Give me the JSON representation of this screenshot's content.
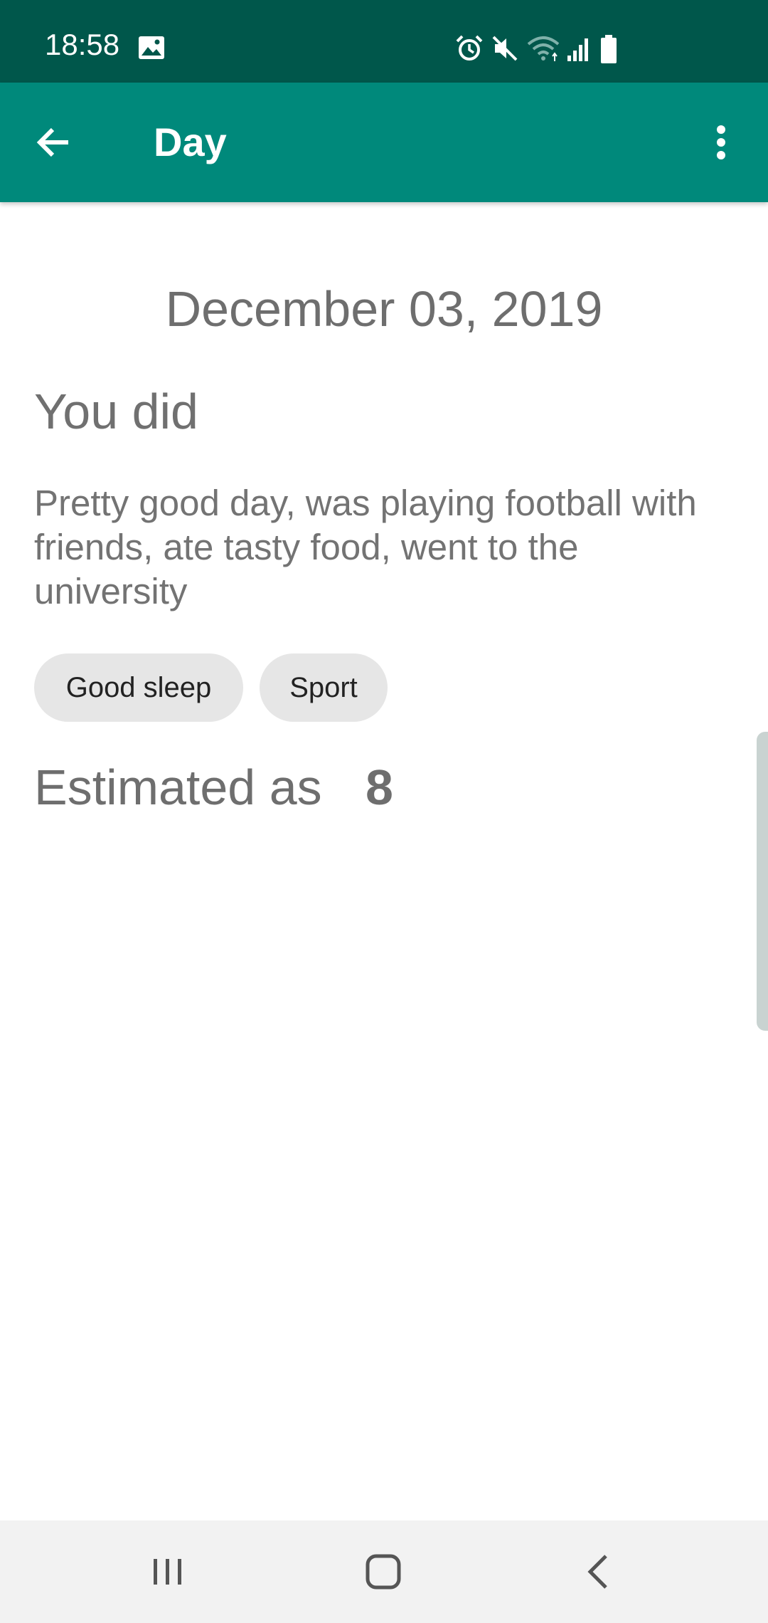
{
  "status_bar": {
    "time": "18:58",
    "icons": [
      "gallery-icon",
      "alarm-icon",
      "mute-icon",
      "wifi-icon",
      "signal-icon",
      "battery-icon"
    ]
  },
  "app_bar": {
    "title": "Day",
    "back_icon": "arrow-back-icon",
    "menu_icon": "more-vert-icon"
  },
  "day": {
    "date": "December 03, 2019",
    "section_heading": "You did",
    "description": "Pretty good day, was playing football with friends, ate tasty food, went to the university",
    "tags": [
      "Good sleep",
      "Sport"
    ],
    "estimate_label": "Estimated as",
    "estimate_value": "8"
  },
  "nav_bar": {
    "buttons": [
      "recents-icon",
      "home-icon",
      "back-icon"
    ]
  },
  "colors": {
    "status_bar": "#00574b",
    "app_bar": "#00897b",
    "chip_background": "#e6e6e6",
    "text_gray": "#6e6e6e",
    "nav_bar": "#f2f2f2"
  }
}
